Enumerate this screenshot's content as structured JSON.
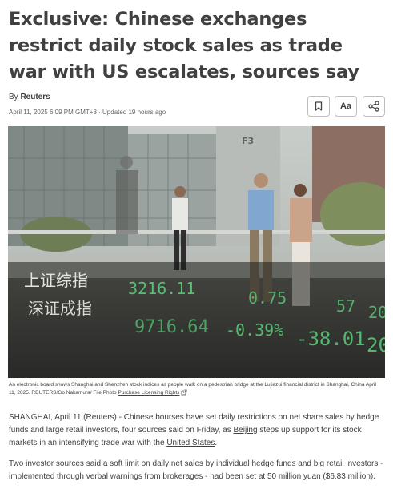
{
  "article": {
    "headline": "Exclusive: Chinese exchanges restrict daily stock sales as trade war with US escalates, sources say",
    "byline_prefix": "By ",
    "author": "Reuters",
    "dateline": "April 11, 2025 6:09 PM GMT+8 · Updated 19 hours ago",
    "toolbar": {
      "text_size_label": "Aa",
      "bookmark_icon": "bookmark-icon",
      "share_icon": "share-icon"
    },
    "photo": {
      "board_text_line1": "上证综指",
      "board_text_line2": "深证成指",
      "ticker_row1": [
        "3216.11",
        "0.75",
        "57",
        "20"
      ],
      "ticker_row2": [
        "9716.64",
        "-0.39%",
        "-38.01",
        "20"
      ],
      "board_code": "F3"
    },
    "caption": {
      "text": "An electronic board shows Shanghai and Shenzhen stock indices as people walk on a pedestrian bridge at the Lujiazui financial district in Shanghai, China April 11, 2025. REUTERS/Go Nakamura/ File Photo ",
      "license_link": "Purchase Licensing Rights"
    },
    "body": {
      "p1_a": "SHANGHAI, April 11 (Reuters) - Chinese bourses have set daily restrictions on net share sales by hedge funds and large retail investors, four sources said on Friday, as ",
      "p1_link1": "Beijing",
      "p1_b": " steps up support for its stock markets in an intensifying trade war with the ",
      "p1_link2": "United States",
      "p1_c": ".",
      "p2": "Two investor sources said a soft limit on daily net sales by individual hedge funds and big retail investors - implemented through verbal warnings from brokerages - had been set at 50 million yuan ($6.83 million)."
    }
  }
}
